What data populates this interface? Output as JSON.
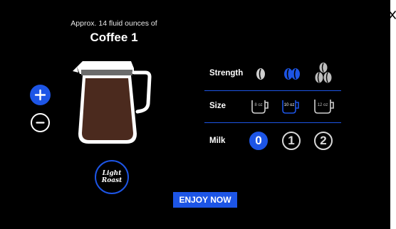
{
  "header": {
    "subtitle": "Approx. 14 fluid ounces of",
    "title": "Coffee 1"
  },
  "roast": {
    "line1": "Light",
    "line2": "Roast"
  },
  "strength": {
    "label": "Strength",
    "options": [
      {
        "icon": "bean-single-icon",
        "selected": false
      },
      {
        "icon": "bean-double-icon",
        "selected": true
      },
      {
        "icon": "bean-triple-icon",
        "selected": false
      }
    ]
  },
  "size": {
    "label": "Size",
    "options": [
      {
        "label": "8 oz",
        "selected": false
      },
      {
        "label": "10 oz",
        "selected": true
      },
      {
        "label": "12 oz",
        "selected": false
      }
    ]
  },
  "milk": {
    "label": "Milk",
    "options": [
      "0",
      "1",
      "2"
    ],
    "selected": "0"
  },
  "action": {
    "label": "ENJOY NOW"
  },
  "colors": {
    "accent": "#1d55e6",
    "coffee": "#4b2a1e",
    "background": "#000000"
  }
}
